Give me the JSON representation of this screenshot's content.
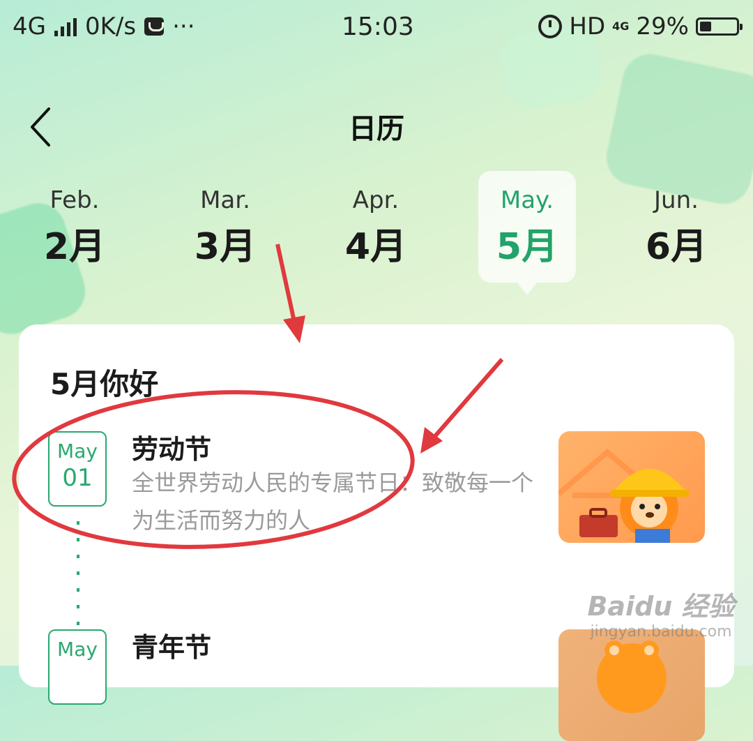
{
  "status_bar": {
    "network": "4G",
    "speed": "0K/s",
    "more": "···",
    "time": "15:03",
    "hd": "HD",
    "net_small": "4G",
    "battery": "29%"
  },
  "header": {
    "title": "日历",
    "back_icon": "chevron-left-icon"
  },
  "months": [
    {
      "en": "Feb.",
      "zh": "2月",
      "active": false
    },
    {
      "en": "Mar.",
      "zh": "3月",
      "active": false
    },
    {
      "en": "Apr.",
      "zh": "4月",
      "active": false
    },
    {
      "en": "May.",
      "zh": "5月",
      "active": true
    },
    {
      "en": "Jun.",
      "zh": "6月",
      "active": false
    }
  ],
  "card": {
    "title": "5月你好",
    "events": [
      {
        "month": "May",
        "day": "01",
        "title": "劳动节",
        "desc": "全世界劳动人民的专属节日：致敬每一个为生活而努力的人"
      },
      {
        "month": "May",
        "day": "",
        "title": "青年节",
        "desc": ""
      }
    ]
  },
  "watermark": {
    "line1": "Baidu 经验",
    "line2": "jingyan.baidu.com"
  },
  "colors": {
    "accent": "#22a36a",
    "annotation": "#e0393e"
  }
}
